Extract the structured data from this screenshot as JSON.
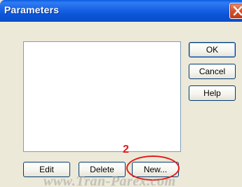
{
  "window": {
    "title": "Parameters"
  },
  "buttons": {
    "ok": "OK",
    "cancel": "Cancel",
    "help": "Help",
    "edit": "Edit",
    "delete": "Delete",
    "new": "New..."
  },
  "annotation": {
    "step_number": "2"
  },
  "watermark": "www.Tran-Parex.com",
  "colors": {
    "annotation": "#e01a1a",
    "titlebar": "#0a55d8"
  }
}
